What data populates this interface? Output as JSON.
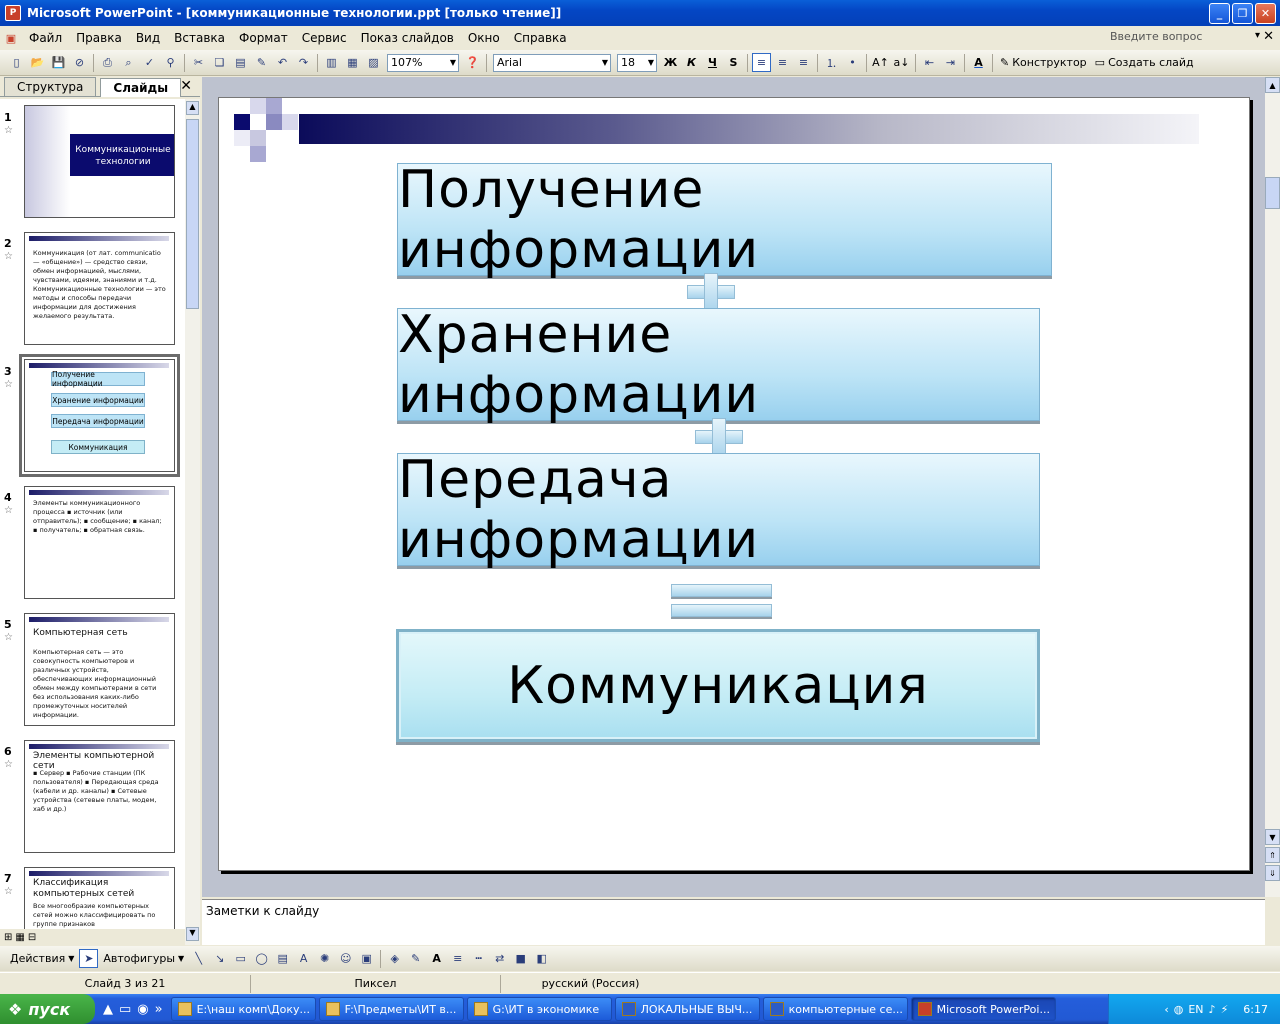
{
  "window": {
    "title": "Microsoft PowerPoint - [коммуникационные технологии.ppt [только чтение]]"
  },
  "menu": [
    "Файл",
    "Правка",
    "Вид",
    "Вставка",
    "Формат",
    "Сервис",
    "Показ слайдов",
    "Окно",
    "Справка"
  ],
  "ask_placeholder": "Введите вопрос",
  "toolbar": {
    "zoom": "107%",
    "font": "Arial",
    "font_size": "18",
    "bold": "Ж",
    "italic": "К",
    "underline": "Ч",
    "shadow": "S",
    "design": "Конструктор",
    "new_slide": "Создать слайд"
  },
  "panel": {
    "tab_outline": "Структура",
    "tab_slides": "Слайды"
  },
  "thumbs": [
    {
      "num": "1",
      "title": "Коммуникационные технологии"
    },
    {
      "num": "2",
      "text": "Коммуникация (от лат. communicatio — «общение») — средство связи, обмен информацией, мыслями, чувствами, идеями, знаниями и т.д. Коммуникационные технологии — это методы и способы передачи информации для достижения желаемого результата."
    },
    {
      "num": "3",
      "items": [
        "Получение информации",
        "Хранение информации",
        "Передача информации",
        "Коммуникация"
      ]
    },
    {
      "num": "4",
      "text": "Элементы коммуникационного процесса ▪ источник (или отправитель); ▪ сообщение; ▪ канал; ▪ получатель; ▪ обратная связь."
    },
    {
      "num": "5",
      "title": "Компьютерная сеть",
      "text": "Компьютерная сеть — это совокупность компьютеров и различных устройств, обеспечивающих информационный обмен между компьютерами в сети без использования каких-либо промежуточных носителей информации."
    },
    {
      "num": "6",
      "title": "Элементы компьютерной сети",
      "text": "▪ Сервер ▪ Рабочие станции (ПК пользователя) ▪ Передающая среда (кабели и др. каналы) ▪ Сетевые устройства (сетевые платы, модем, хаб и др.)"
    },
    {
      "num": "7",
      "title": "Классификация компьютерных сетей",
      "text": "Все многообразие компьютерных сетей можно классифицировать по группе признаков"
    }
  ],
  "slide": {
    "boxes": [
      "Получение информации",
      "Хранение информации",
      "Передача информации"
    ],
    "result": "Коммуникация"
  },
  "notes_placeholder": "Заметки к слайду",
  "drawbar": {
    "actions": "Действия",
    "autoshapes": "Автофигуры"
  },
  "status": {
    "slide_pos": "Слайд 3 из 21",
    "template": "Пиксел",
    "language": "русский (Россия)"
  },
  "taskbar": {
    "start": "пуск",
    "tasks": [
      "E:\\наш комп\\Доку...",
      "F:\\Предметы\\ИТ в...",
      "G:\\ИТ в экономике",
      "ЛОКАЛЬНЫЕ ВЫЧ...",
      "компьютерные се...",
      "Microsoft PowerPoi..."
    ],
    "clock": "6:17"
  },
  "colors": {
    "title_bar": "#0446c4",
    "slide_box": "#bde4f6",
    "slide_bar_dark": "#0b0b5a"
  }
}
